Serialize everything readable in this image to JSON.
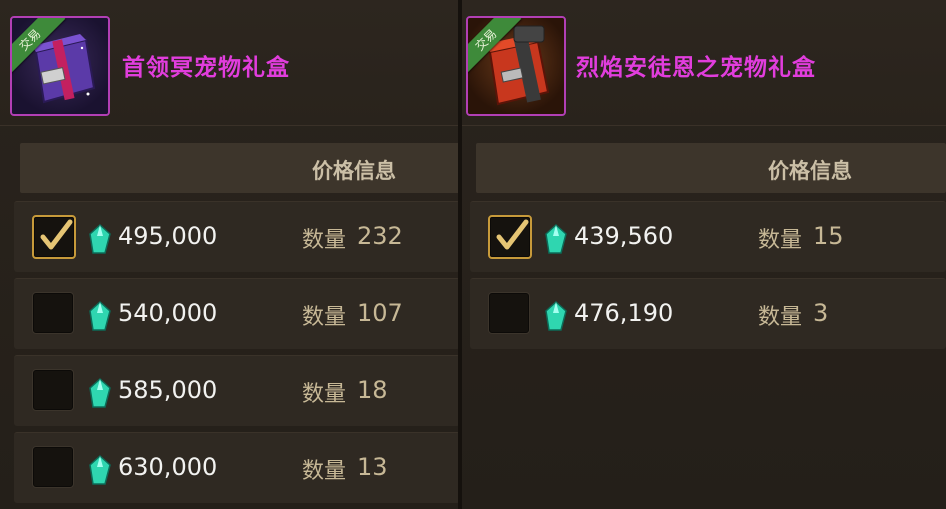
{
  "items": [
    {
      "trade_tag": "交易",
      "title": "首领冥宠物礼盒",
      "price_header": "价格信息",
      "listings": [
        {
          "price": "495,000",
          "qty_label": "数量",
          "qty": "232",
          "checked": true
        },
        {
          "price": "540,000",
          "qty_label": "数量",
          "qty": "107",
          "checked": false
        },
        {
          "price": "585,000",
          "qty_label": "数量",
          "qty": "18",
          "checked": false
        },
        {
          "price": "630,000",
          "qty_label": "数量",
          "qty": "13",
          "checked": false
        }
      ]
    },
    {
      "trade_tag": "交易",
      "title": "烈焰安徒恩之宠物礼盒",
      "price_header": "价格信息",
      "listings": [
        {
          "price": "439,560",
          "qty_label": "数量",
          "qty": "15",
          "checked": true
        },
        {
          "price": "476,190",
          "qty_label": "数量",
          "qty": "3",
          "checked": false
        }
      ]
    }
  ],
  "colors": {
    "title": "#e13ddd",
    "price": "#f2f2f0",
    "qty": "#c7b896",
    "gem": "#2fd6b0",
    "check": "#e6c574"
  },
  "icons": {
    "left_item": "purple-gift-box-icon",
    "right_item": "red-gift-box-icon",
    "currency": "crystal-gem-icon",
    "checkbox": "checkmark-icon"
  }
}
